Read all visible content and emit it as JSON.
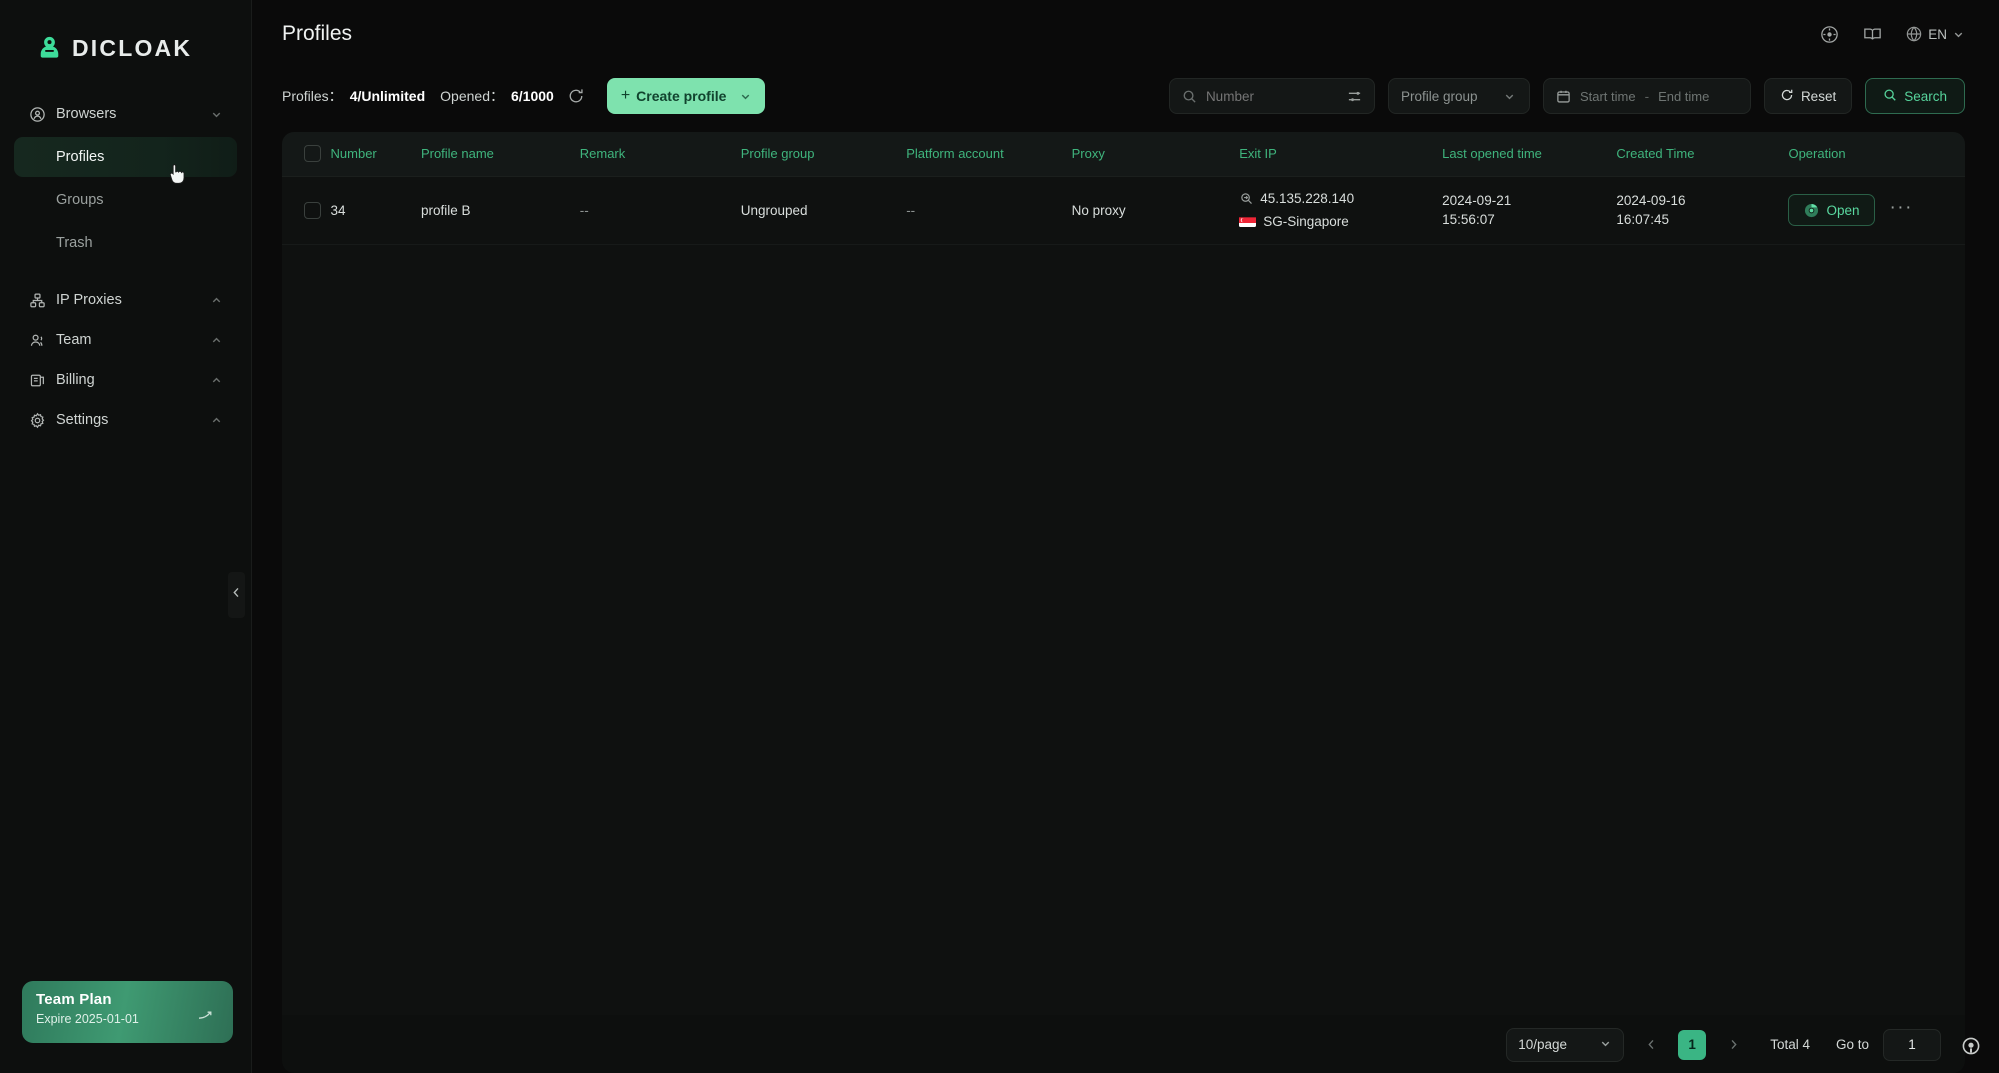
{
  "brand": {
    "name": "DICLOAK",
    "logo_icon": "dicloak-logo-icon",
    "accent": "#7ee2ae",
    "accent_dark": "#3ab584"
  },
  "sidebar": {
    "groups": [
      {
        "label": "Browsers",
        "icon": "browser-globe-icon",
        "chevron": "chevron-down-icon",
        "items": [
          {
            "label": "Profiles",
            "active": true
          },
          {
            "label": "Groups",
            "active": false
          },
          {
            "label": "Trash",
            "active": false
          }
        ]
      },
      {
        "label": "IP Proxies",
        "icon": "proxy-grid-icon",
        "chevron": "chevron-up-icon",
        "items": []
      },
      {
        "label": "Team",
        "icon": "team-users-icon",
        "chevron": "chevron-up-icon",
        "items": []
      },
      {
        "label": "Billing",
        "icon": "billing-card-icon",
        "chevron": "chevron-up-icon",
        "items": []
      },
      {
        "label": "Settings",
        "icon": "gear-icon",
        "chevron": "chevron-up-icon",
        "items": []
      }
    ],
    "plan": {
      "title": "Team Plan",
      "expire": "Expire 2025-01-01",
      "arrow_icon": "arrow-up-right-icon"
    },
    "collapse_icon": "chevron-left-icon"
  },
  "header": {
    "title": "Profiles",
    "icons": [
      {
        "name": "download-target-icon"
      },
      {
        "name": "book-manual-icon"
      }
    ],
    "language": {
      "icon": "globe-icon",
      "label": "EN",
      "chevron": "chevron-down-icon"
    }
  },
  "toolbar": {
    "profiles_label": "Profiles：",
    "profiles_value": "4/Unlimited",
    "opened_label": "Opened：",
    "opened_value": "6/1000",
    "refresh_icon": "refresh-icon",
    "create_button": {
      "plus": "+",
      "label": "Create profile",
      "chevron": "chevron-down-icon"
    },
    "search": {
      "icon": "search-icon",
      "placeholder": "Number",
      "filter_icon": "sliders-filter-icon"
    },
    "profile_group": {
      "placeholder": "Profile group",
      "chevron": "chevron-down-icon"
    },
    "daterange": {
      "icon": "calendar-icon",
      "start_placeholder": "Start time",
      "separator": "-",
      "end_placeholder": "End time"
    },
    "reset_button": {
      "icon": "refresh-icon",
      "label": "Reset"
    },
    "search_button": {
      "icon": "search-icon",
      "label": "Search"
    }
  },
  "table": {
    "columns": [
      {
        "key": "checkbox",
        "label": ""
      },
      {
        "key": "number",
        "label": "Number"
      },
      {
        "key": "profile_name",
        "label": "Profile name"
      },
      {
        "key": "remark",
        "label": "Remark"
      },
      {
        "key": "profile_group",
        "label": "Profile group"
      },
      {
        "key": "platform_account",
        "label": "Platform account"
      },
      {
        "key": "proxy",
        "label": "Proxy"
      },
      {
        "key": "exit_ip",
        "label": "Exit IP"
      },
      {
        "key": "last_opened_time",
        "label": "Last opened time"
      },
      {
        "key": "created_time",
        "label": "Created Time"
      },
      {
        "key": "operation",
        "label": "Operation"
      }
    ],
    "rows": [
      {
        "number": "34",
        "profile_name": "profile B",
        "remark": "--",
        "profile_group": "Ungrouped",
        "platform_account": "--",
        "proxy": "No proxy",
        "exit_ip_address": "45.135.228.140",
        "exit_ip_location": "SG-Singapore",
        "exit_ip_icon": "ip-lookup-icon",
        "flag_icon": "singapore-flag-icon",
        "last_opened_date": "2024-09-21",
        "last_opened_clock": "15:56:07",
        "created_date": "2024-09-16",
        "created_clock": "16:07:45",
        "open_button": {
          "icon": "chrome-icon",
          "label": "Open"
        },
        "more_button": "···"
      }
    ]
  },
  "footer": {
    "page_size": {
      "label": "10/page",
      "chevron": "chevron-down-icon"
    },
    "prev_icon": "chevron-left-icon",
    "next_icon": "chevron-right-icon",
    "current_page": "1",
    "total_label": "Total 4",
    "goto_label": "Go to",
    "goto_value": "1"
  },
  "overlay": {
    "cursor_icon": "pointer-cursor-icon",
    "recorder_icon": "recording-indicator-icon"
  }
}
